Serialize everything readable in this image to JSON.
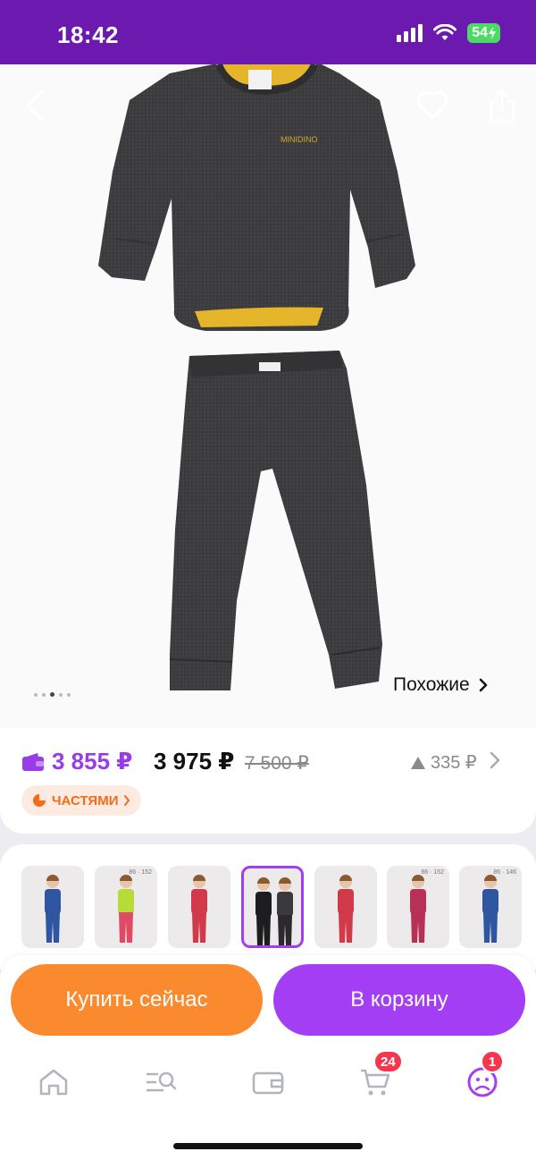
{
  "status_bar": {
    "time": "18:42",
    "battery": "54"
  },
  "colors": {
    "brand_purple": "#6c19b0",
    "accent_purple": "#a33ef5",
    "buy_orange": "#fb8a2e",
    "wallet_purple": "#9a3be8",
    "badge_red": "#f5364f"
  },
  "gallery": {
    "similar_label": "Похожие",
    "image_count": 4,
    "active_image": 2,
    "icons": {
      "back": "chevron-left-icon",
      "favorite": "heart-icon",
      "share": "share-icon"
    }
  },
  "price": {
    "wallet_price": "3 855 ₽",
    "regular_price": "3 975 ₽",
    "old_price": "7 500 ₽",
    "price_change": "335 ₽",
    "installments_label": "ЧАСТЯМИ"
  },
  "variants": {
    "selected_index": 3,
    "items": [
      {
        "label": "",
        "top": "#2f56a0",
        "bottom": "#2f56a0"
      },
      {
        "label": "86 · 152",
        "top": "#b7dc3a",
        "bottom": "#e04a64"
      },
      {
        "label": "",
        "top": "#d23a4a",
        "bottom": "#d23a4a"
      },
      {
        "label": "",
        "top": "#222",
        "bottom": "#222"
      },
      {
        "label": "",
        "top": "#d23a4a",
        "bottom": "#d23a4a"
      },
      {
        "label": "86 · 152",
        "top": "#b83057",
        "bottom": "#b83057"
      },
      {
        "label": "86 · 146",
        "top": "#2f56a0",
        "bottom": "#2f56a0"
      }
    ]
  },
  "actions": {
    "buy_now": "Купить сейчас",
    "add_to_cart": "В корзину"
  },
  "tabbar": {
    "items": [
      {
        "name": "home",
        "icon": "home-icon"
      },
      {
        "name": "catalog",
        "icon": "catalog-search-icon"
      },
      {
        "name": "wallet",
        "icon": "wallet-icon"
      },
      {
        "name": "cart",
        "icon": "cart-icon",
        "badge": "24"
      },
      {
        "name": "profile",
        "icon": "profile-icon",
        "badge": "1"
      }
    ]
  }
}
